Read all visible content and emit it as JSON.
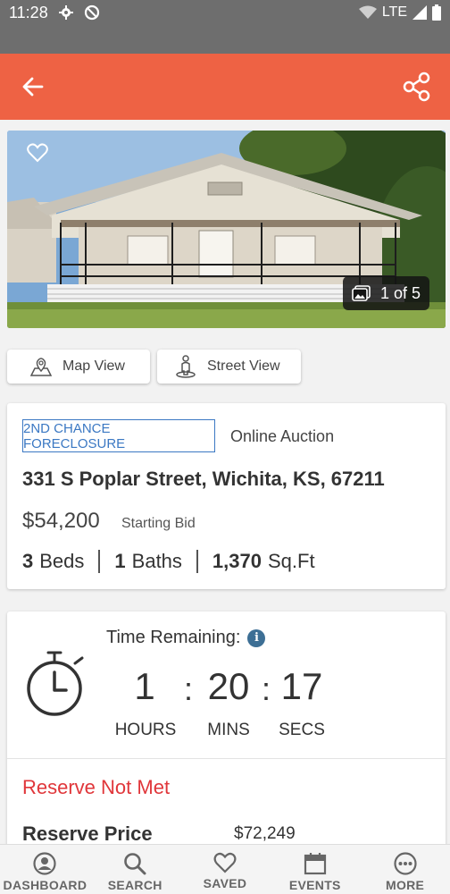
{
  "status_bar": {
    "time": "11:28",
    "network": "LTE"
  },
  "header": {
    "back_icon": "arrow-left-icon",
    "share_icon": "share-icon",
    "accent_color": "#ee6244"
  },
  "hero": {
    "photo_index": "1 of 5"
  },
  "views": {
    "map_label": "Map View",
    "street_label": "Street View"
  },
  "listing": {
    "badge": "2ND CHANCE FORECLOSURE",
    "auction_type": "Online Auction",
    "address": "331 S Poplar Street, Wichita, KS, 67211",
    "price": "$54,200",
    "price_label": "Starting Bid",
    "beds_value": "3",
    "beds_label": "Beds",
    "baths_value": "1",
    "baths_label": "Baths",
    "sqft_value": "1,370",
    "sqft_label": "Sq.Ft"
  },
  "timer": {
    "label": "Time Remaining:",
    "hours": "1",
    "mins": "20",
    "secs": "17",
    "hours_label": "HOURS",
    "mins_label": "MINS",
    "secs_label": "SECS",
    "separator": ":"
  },
  "reserve": {
    "status": "Reserve Not Met",
    "label": "Reserve Price",
    "value": "$72,249",
    "status_color": "#e0363a"
  },
  "nav": {
    "dashboard": "DASHBOARD",
    "search": "SEARCH",
    "saved": "SAVED",
    "events": "EVENTS",
    "more": "MORE"
  }
}
